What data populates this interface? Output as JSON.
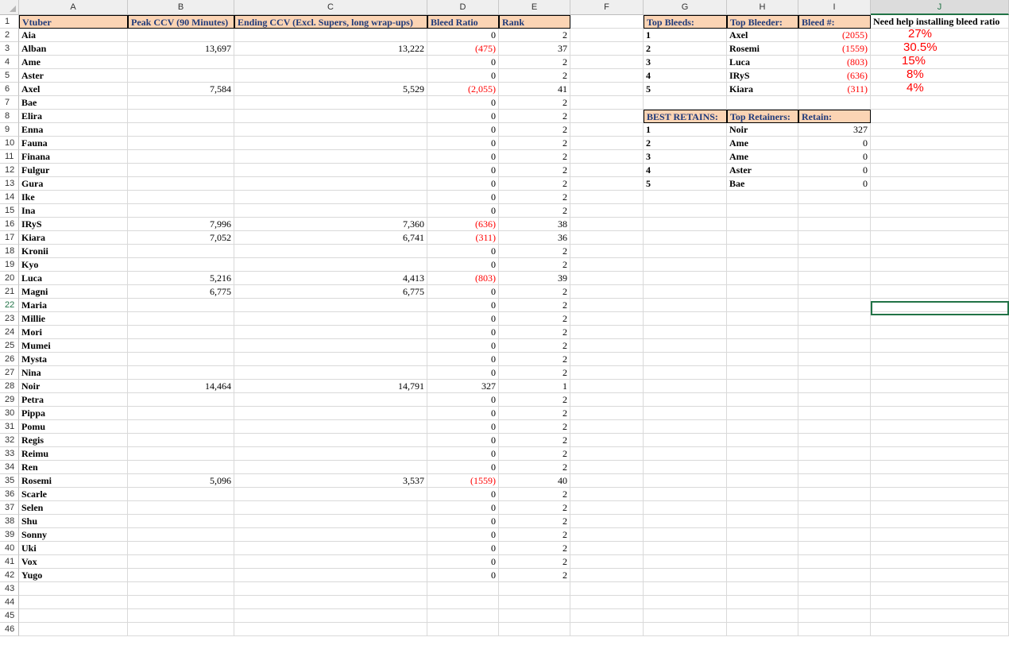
{
  "columns": [
    "A",
    "B",
    "C",
    "D",
    "E",
    "F",
    "G",
    "H",
    "I",
    "J"
  ],
  "selected_column": "J",
  "selected_row": 22,
  "row_numbers": [
    1,
    2,
    3,
    4,
    5,
    6,
    7,
    8,
    9,
    10,
    11,
    12,
    13,
    14,
    15,
    16,
    17,
    18,
    19,
    20,
    21,
    22,
    23,
    24,
    25,
    26,
    27,
    28,
    29,
    30,
    31,
    32,
    33,
    34,
    35,
    36,
    37,
    38,
    39,
    40,
    41,
    42,
    43,
    44,
    45,
    46
  ],
  "main_headers": {
    "vtuber": "Vtuber",
    "peak": "Peak CCV (90 Minutes)",
    "ending": "Ending CCV (Excl. Supers, long wrap-ups)",
    "ratio": "Bleed Ratio",
    "rank": "Rank"
  },
  "rows": [
    {
      "name": "Aia",
      "peak": "",
      "ending": "",
      "ratio": "0",
      "rank": "2"
    },
    {
      "name": "Alban",
      "peak": "13,697",
      "ending": "13,222",
      "ratio": "(475)",
      "rank": "37"
    },
    {
      "name": "Ame",
      "peak": "",
      "ending": "",
      "ratio": "0",
      "rank": "2"
    },
    {
      "name": "Aster",
      "peak": "",
      "ending": "",
      "ratio": "0",
      "rank": "2"
    },
    {
      "name": "Axel",
      "peak": "7,584",
      "ending": "5,529",
      "ratio": "(2,055)",
      "rank": "41"
    },
    {
      "name": "Bae",
      "peak": "",
      "ending": "",
      "ratio": "0",
      "rank": "2"
    },
    {
      "name": "Elira",
      "peak": "",
      "ending": "",
      "ratio": "0",
      "rank": "2"
    },
    {
      "name": "Enna",
      "peak": "",
      "ending": "",
      "ratio": "0",
      "rank": "2"
    },
    {
      "name": "Fauna",
      "peak": "",
      "ending": "",
      "ratio": "0",
      "rank": "2"
    },
    {
      "name": "Finana",
      "peak": "",
      "ending": "",
      "ratio": "0",
      "rank": "2"
    },
    {
      "name": "Fulgur",
      "peak": "",
      "ending": "",
      "ratio": "0",
      "rank": "2"
    },
    {
      "name": "Gura",
      "peak": "",
      "ending": "",
      "ratio": "0",
      "rank": "2"
    },
    {
      "name": "Ike",
      "peak": "",
      "ending": "",
      "ratio": "0",
      "rank": "2"
    },
    {
      "name": "Ina",
      "peak": "",
      "ending": "",
      "ratio": "0",
      "rank": "2"
    },
    {
      "name": "IRyS",
      "peak": "7,996",
      "ending": "7,360",
      "ratio": "(636)",
      "rank": "38"
    },
    {
      "name": "Kiara",
      "peak": "7,052",
      "ending": "6,741",
      "ratio": "(311)",
      "rank": "36"
    },
    {
      "name": "Kronii",
      "peak": "",
      "ending": "",
      "ratio": "0",
      "rank": "2"
    },
    {
      "name": "Kyo",
      "peak": "",
      "ending": "",
      "ratio": "0",
      "rank": "2"
    },
    {
      "name": "Luca",
      "peak": "5,216",
      "ending": "4,413",
      "ratio": "(803)",
      "rank": "39"
    },
    {
      "name": "Magni",
      "peak": "6,775",
      "ending": "6,775",
      "ratio": "0",
      "rank": "2"
    },
    {
      "name": "Maria",
      "peak": "",
      "ending": "",
      "ratio": "0",
      "rank": "2"
    },
    {
      "name": "Millie",
      "peak": "",
      "ending": "",
      "ratio": "0",
      "rank": "2"
    },
    {
      "name": "Mori",
      "peak": "",
      "ending": "",
      "ratio": "0",
      "rank": "2"
    },
    {
      "name": "Mumei",
      "peak": "",
      "ending": "",
      "ratio": "0",
      "rank": "2"
    },
    {
      "name": "Mysta",
      "peak": "",
      "ending": "",
      "ratio": "0",
      "rank": "2"
    },
    {
      "name": "Nina",
      "peak": "",
      "ending": "",
      "ratio": "0",
      "rank": "2"
    },
    {
      "name": "Noir",
      "peak": "14,464",
      "ending": "14,791",
      "ratio": "327",
      "rank": "1"
    },
    {
      "name": "Petra",
      "peak": "",
      "ending": "",
      "ratio": "0",
      "rank": "2"
    },
    {
      "name": "Pippa",
      "peak": "",
      "ending": "",
      "ratio": "0",
      "rank": "2"
    },
    {
      "name": "Pomu",
      "peak": "",
      "ending": "",
      "ratio": "0",
      "rank": "2"
    },
    {
      "name": "Regis",
      "peak": "",
      "ending": "",
      "ratio": "0",
      "rank": "2"
    },
    {
      "name": "Reimu",
      "peak": "",
      "ending": "",
      "ratio": "0",
      "rank": "2"
    },
    {
      "name": "Ren",
      "peak": "",
      "ending": "",
      "ratio": "0",
      "rank": "2"
    },
    {
      "name": "Rosemi",
      "peak": "5,096",
      "ending": "3,537",
      "ratio": "(1559)",
      "rank": "40"
    },
    {
      "name": "Scarle",
      "peak": "",
      "ending": "",
      "ratio": "0",
      "rank": "2"
    },
    {
      "name": "Selen",
      "peak": "",
      "ending": "",
      "ratio": "0",
      "rank": "2"
    },
    {
      "name": "Shu",
      "peak": "",
      "ending": "",
      "ratio": "0",
      "rank": "2"
    },
    {
      "name": "Sonny",
      "peak": "",
      "ending": "",
      "ratio": "0",
      "rank": "2"
    },
    {
      "name": "Uki",
      "peak": "",
      "ending": "",
      "ratio": "0",
      "rank": "2"
    },
    {
      "name": "Vox",
      "peak": "",
      "ending": "",
      "ratio": "0",
      "rank": "2"
    },
    {
      "name": "Yugo",
      "peak": "",
      "ending": "",
      "ratio": "0",
      "rank": "2"
    }
  ],
  "bleeds": {
    "headers": {
      "a": "Top Bleeds:",
      "b": "Top Bleeder:",
      "c": "Bleed #:"
    },
    "rows": [
      {
        "rank": "1",
        "name": "Axel",
        "value": "(2055)"
      },
      {
        "rank": "2",
        "name": "Rosemi",
        "value": "(1559)"
      },
      {
        "rank": "3",
        "name": "Luca",
        "value": "(803)"
      },
      {
        "rank": "4",
        "name": "IRyS",
        "value": "(636)"
      },
      {
        "rank": "5",
        "name": "Kiara",
        "value": "(311)"
      }
    ]
  },
  "retains": {
    "headers": {
      "a": "BEST RETAINS:",
      "b": "Top Retainers:",
      "c": "Retain:"
    },
    "rows": [
      {
        "rank": "1",
        "name": "Noir",
        "value": "327"
      },
      {
        "rank": "2",
        "name": "Ame",
        "value": "0"
      },
      {
        "rank": "3",
        "name": "Ame",
        "value": "0"
      },
      {
        "rank": "4",
        "name": "Aster",
        "value": "0"
      },
      {
        "rank": "5",
        "name": "Bae",
        "value": "0"
      }
    ]
  },
  "note": "Need help installing bleed ratio",
  "percentages": [
    "27%",
    "30.5%",
    "15%",
    "8%",
    "4%"
  ],
  "colors": {
    "header_fill": "#fbd4b4",
    "header_text": "#1f3a7a",
    "negative": "#ff0000",
    "selection": "#217346"
  }
}
